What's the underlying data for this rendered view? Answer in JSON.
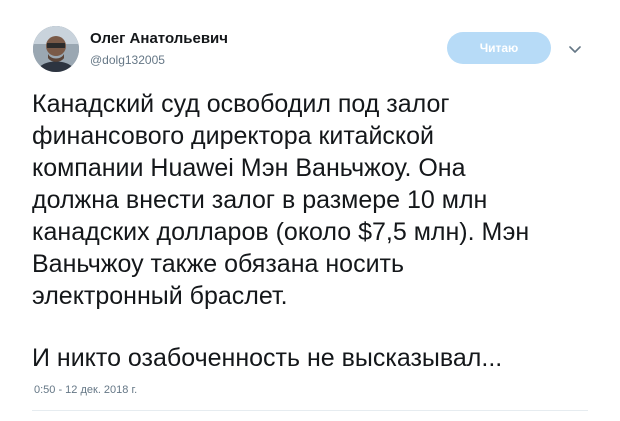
{
  "author": {
    "name": "Олег Анатольевич",
    "handle": "@dolg132005"
  },
  "follow_button": {
    "label": "Читаю"
  },
  "tweet": {
    "lines": [
      "Канадский суд освободил под залог",
      "финансового директора китайской",
      "компании Huawei Мэн Ваньчжоу. Она",
      "должна внести залог в размере 10 млн",
      "канадских долларов (около $7,5 млн). Мэн",
      "Ваньчжоу также обязана носить",
      "электронный браслет."
    ],
    "closing_line": "И никто озабоченность не высказывал...",
    "timestamp": "0:50 - 12 дек. 2018 г."
  },
  "icons": {
    "caret": "chevron-down-icon",
    "avatar": "avatar"
  },
  "colors": {
    "follow_button_bg": "#b7dbf7",
    "secondary_text": "#657786",
    "primary_text": "#14171a"
  }
}
